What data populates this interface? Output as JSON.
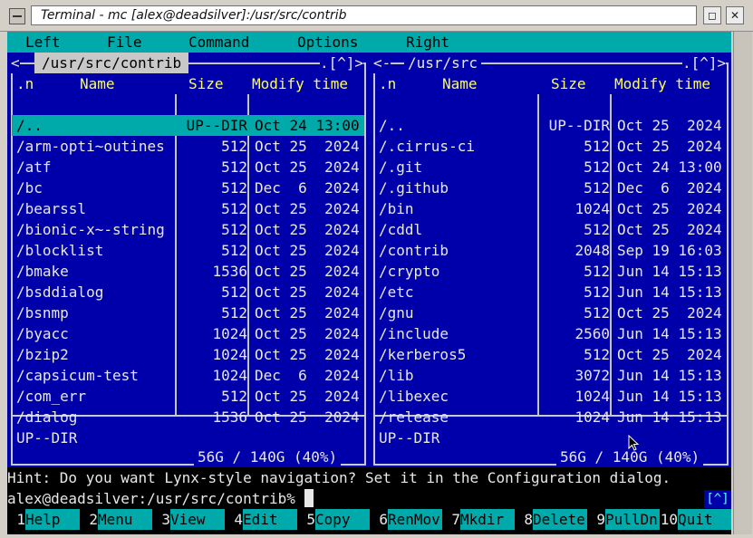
{
  "window": {
    "title": "Terminal - mc [alex@deadsilver]:/usr/src/contrib"
  },
  "menu": [
    "Left",
    "File",
    "Command",
    "Options",
    "Right"
  ],
  "left_panel": {
    "path": "/usr/src/contrib",
    "corner": ".[^]>",
    "corner_left": "<",
    "headers": {
      "name_sort": ".n",
      "name": "Name",
      "size": "Size",
      "mtime": "Modify time"
    },
    "rows": [
      {
        "name": "/..",
        "size": "UP--DIR",
        "mtime": "Oct 24 13:00",
        "selected": true
      },
      {
        "name": "/arm-opti~outines",
        "size": "512",
        "mtime": "Oct 25  2024"
      },
      {
        "name": "/atf",
        "size": "512",
        "mtime": "Oct 25  2024"
      },
      {
        "name": "/bc",
        "size": "512",
        "mtime": "Dec  6  2024"
      },
      {
        "name": "/bearssl",
        "size": "512",
        "mtime": "Oct 25  2024"
      },
      {
        "name": "/bionic-x~-string",
        "size": "512",
        "mtime": "Oct 25  2024"
      },
      {
        "name": "/blocklist",
        "size": "512",
        "mtime": "Oct 25  2024"
      },
      {
        "name": "/bmake",
        "size": "1536",
        "mtime": "Oct 25  2024"
      },
      {
        "name": "/bsddialog",
        "size": "512",
        "mtime": "Oct 25  2024"
      },
      {
        "name": "/bsnmp",
        "size": "512",
        "mtime": "Oct 25  2024"
      },
      {
        "name": "/byacc",
        "size": "1024",
        "mtime": "Oct 25  2024"
      },
      {
        "name": "/bzip2",
        "size": "1024",
        "mtime": "Oct 25  2024"
      },
      {
        "name": "/capsicum-test",
        "size": "1024",
        "mtime": "Dec  6  2024"
      },
      {
        "name": "/com_err",
        "size": "512",
        "mtime": "Oct 25  2024"
      },
      {
        "name": "/dialog",
        "size": "1536",
        "mtime": "Oct 25  2024"
      }
    ],
    "mini_status": "UP--DIR",
    "usage": "56G / 140G (40%)"
  },
  "right_panel": {
    "path": "/usr/src",
    "corner": ".[^]>",
    "corner_left": "<-",
    "headers": {
      "name_sort": ".n",
      "name": "Name",
      "size": "Size",
      "mtime": "Modify time"
    },
    "rows": [
      {
        "name": "/..",
        "size": "UP--DIR",
        "mtime": "Oct 25  2024"
      },
      {
        "name": "/.cirrus-ci",
        "size": "512",
        "mtime": "Oct 25  2024"
      },
      {
        "name": "/.git",
        "size": "512",
        "mtime": "Oct 24 13:00"
      },
      {
        "name": "/.github",
        "size": "512",
        "mtime": "Dec  6  2024"
      },
      {
        "name": "/bin",
        "size": "1024",
        "mtime": "Oct 25  2024"
      },
      {
        "name": "/cddl",
        "size": "512",
        "mtime": "Oct 25  2024"
      },
      {
        "name": "/contrib",
        "size": "2048",
        "mtime": "Sep 19 16:03"
      },
      {
        "name": "/crypto",
        "size": "512",
        "mtime": "Jun 14 15:13"
      },
      {
        "name": "/etc",
        "size": "512",
        "mtime": "Jun 14 15:13"
      },
      {
        "name": "/gnu",
        "size": "512",
        "mtime": "Oct 25  2024"
      },
      {
        "name": "/include",
        "size": "2560",
        "mtime": "Jun 14 15:13"
      },
      {
        "name": "/kerberos5",
        "size": "512",
        "mtime": "Oct 25  2024"
      },
      {
        "name": "/lib",
        "size": "3072",
        "mtime": "Jun 14 15:13"
      },
      {
        "name": "/libexec",
        "size": "1024",
        "mtime": "Jun 14 15:13"
      },
      {
        "name": "/release",
        "size": "1024",
        "mtime": "Jun 14 15:13"
      }
    ],
    "mini_status": "UP--DIR",
    "usage": "56G / 140G (40%)"
  },
  "hint": "Hint: Do you want Lynx-style navigation? Set it in the Configuration dialog.",
  "prompt": "alex@deadsilver:/usr/src/contrib%",
  "history_button": "[^]",
  "fkeys": [
    {
      "num": "1",
      "label": "Help"
    },
    {
      "num": "2",
      "label": "Menu"
    },
    {
      "num": "3",
      "label": "View"
    },
    {
      "num": "4",
      "label": "Edit"
    },
    {
      "num": "5",
      "label": "Copy"
    },
    {
      "num": "6",
      "label": "RenMov"
    },
    {
      "num": "7",
      "label": "Mkdir"
    },
    {
      "num": "8",
      "label": "Delete"
    },
    {
      "num": "9",
      "label": "PullDn"
    },
    {
      "num": "10",
      "label": "Quit"
    }
  ],
  "colors": {
    "panel_bg": "#0000aa",
    "accent": "#00aaaa",
    "header_fg": "#ffff55",
    "frame": "#c8c8c8"
  },
  "icons": {
    "window_menu": "window-menu-icon",
    "shade": "shade-icon",
    "close": "close-icon"
  }
}
